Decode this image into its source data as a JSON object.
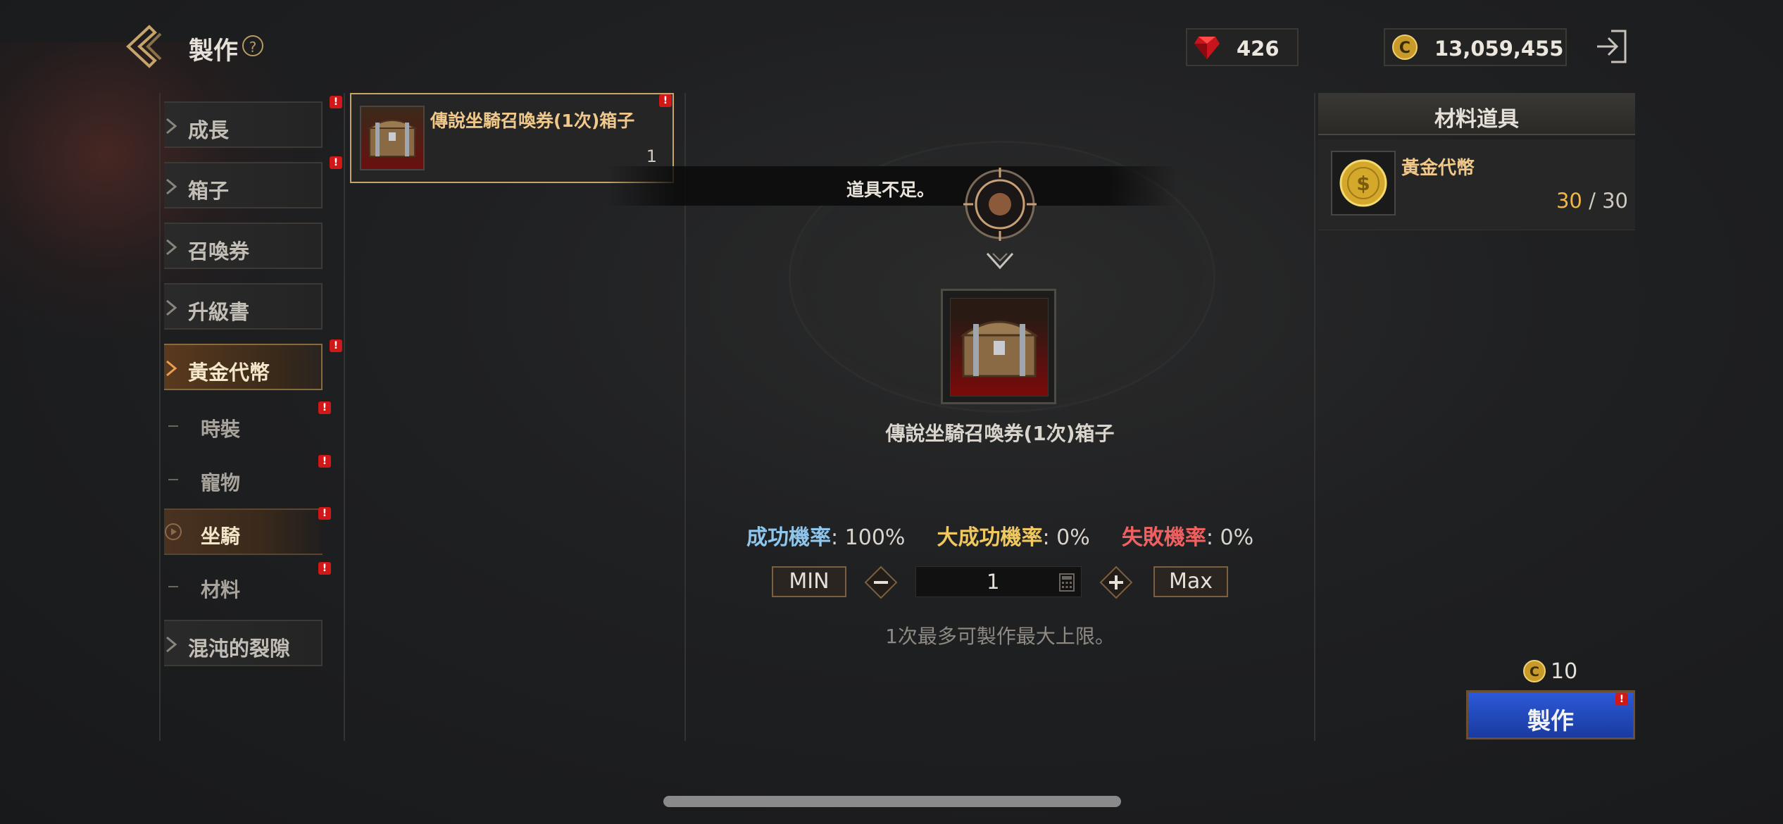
{
  "header": {
    "title": "製作",
    "help_symbol": "?",
    "ruby_amount": "426",
    "gold_amount": "13,059,455"
  },
  "menu": {
    "categories": [
      {
        "label": "成長",
        "badge": true
      },
      {
        "label": "箱子",
        "badge": true
      },
      {
        "label": "召喚券",
        "badge": false
      },
      {
        "label": "升級書",
        "badge": false
      },
      {
        "label": "黃金代幣",
        "badge": true,
        "active": true
      },
      {
        "label": "混沌的裂隙",
        "badge": false
      }
    ],
    "subitems": [
      {
        "label": "時裝",
        "badge": true
      },
      {
        "label": "寵物",
        "badge": true
      },
      {
        "label": "坐騎",
        "badge": true,
        "active": true
      },
      {
        "label": "材料",
        "badge": true
      }
    ]
  },
  "recipe": {
    "name": "傳說坐騎召喚券(1次)箱子",
    "quantity": "1",
    "badge_symbol": "!"
  },
  "toast": {
    "message": "道具不足。"
  },
  "detail": {
    "item_name": "傳說坐騎召喚券(1次)箱子",
    "success_label": "成功機率",
    "success_value": ": 100%",
    "great_label": "大成功機率",
    "great_value": ": 0%",
    "fail_label": "失敗機率",
    "fail_value": ": 0%",
    "min_label": "MIN",
    "max_label": "Max",
    "minus_symbol": "−",
    "plus_symbol": "+",
    "quantity": "1",
    "hint": "1次最多可製作最大上限。"
  },
  "materials": {
    "header": "材料道具",
    "items": [
      {
        "name": "黃金代幣",
        "have": "30",
        "separator": " / ",
        "need": "30"
      }
    ]
  },
  "craft": {
    "cost": "10",
    "label": "製作",
    "badge_symbol": "!"
  },
  "colors": {
    "success": "#8ec6ec",
    "great": "#f0c860",
    "fail": "#f06060",
    "accent_gold": "#c8a46a",
    "craft_blue": "#2c5ad8"
  },
  "icons": [
    "back-icon",
    "help-icon",
    "ruby-icon",
    "gold-coin-icon",
    "exit-icon",
    "chest-icon",
    "calculator-icon",
    "chevron-down-icon"
  ]
}
